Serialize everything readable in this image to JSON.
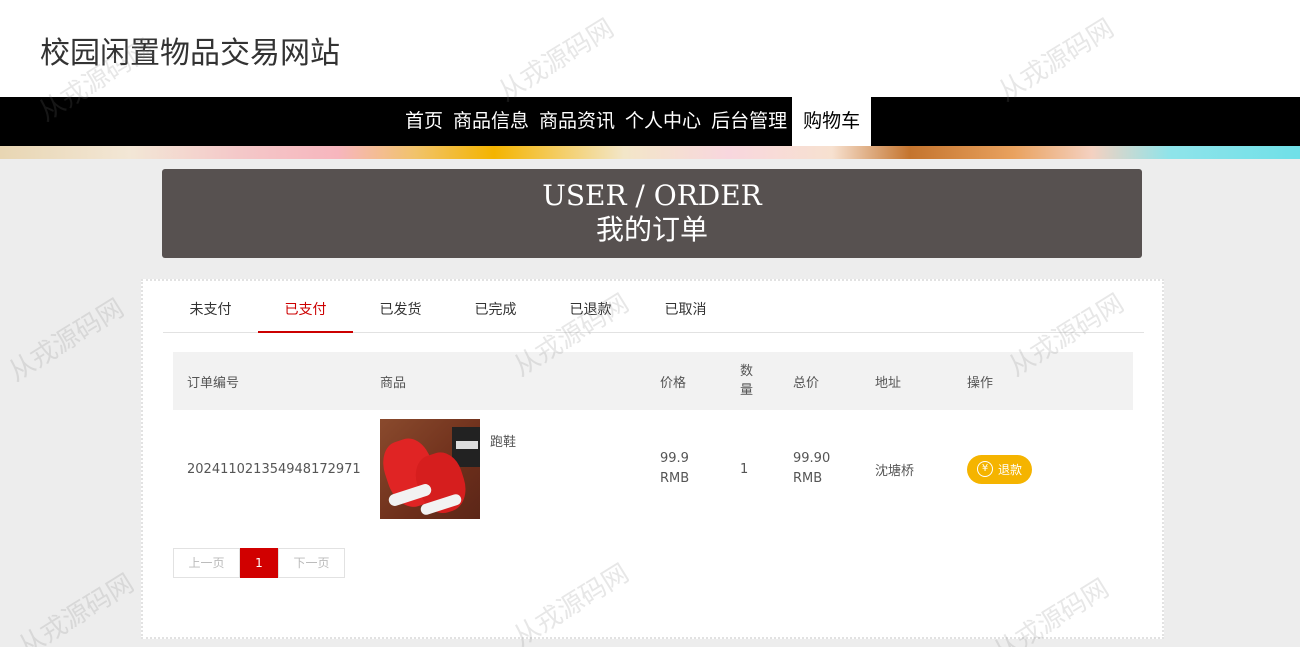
{
  "site": {
    "title": "校园闲置物品交易网站"
  },
  "nav": {
    "items": [
      {
        "label": "首页"
      },
      {
        "label": "商品信息"
      },
      {
        "label": "商品资讯"
      },
      {
        "label": "个人中心"
      },
      {
        "label": "后台管理"
      },
      {
        "label": "购物车"
      }
    ],
    "active": "购物车"
  },
  "header": {
    "en": "USER / ORDER",
    "cn": "我的订单"
  },
  "tabs": {
    "items": [
      {
        "label": "未支付"
      },
      {
        "label": "已支付"
      },
      {
        "label": "已发货"
      },
      {
        "label": "已完成"
      },
      {
        "label": "已退款"
      },
      {
        "label": "已取消"
      }
    ],
    "active": "已支付"
  },
  "table": {
    "headers": {
      "order_no": "订单编号",
      "product": "商品",
      "price": "价格",
      "qty_1": "数",
      "qty_2": "量",
      "total": "总价",
      "address": "地址",
      "action": "操作"
    },
    "rows": [
      {
        "order_no": "20241102135494817297 1",
        "order_no_display": "202411021354948172971",
        "product_name": "跑鞋",
        "product_icon": "red-running-shoes-image",
        "price_value": "99.9",
        "price_unit": "RMB",
        "qty": "1",
        "total_value": "99.90",
        "total_unit": "RMB",
        "address": "沈塘桥",
        "action_label": "退款",
        "action_icon": "yen-icon",
        "action_symbol": "¥"
      }
    ]
  },
  "pager": {
    "prev": "上一页",
    "current": "1",
    "next": "下一页"
  },
  "watermark": "从戎源码网",
  "colors": {
    "accent": "#cc0000",
    "nav_bg": "#000000",
    "header_bg": "#575150",
    "refund_btn": "#f5b400",
    "pager_current": "#d10000"
  }
}
